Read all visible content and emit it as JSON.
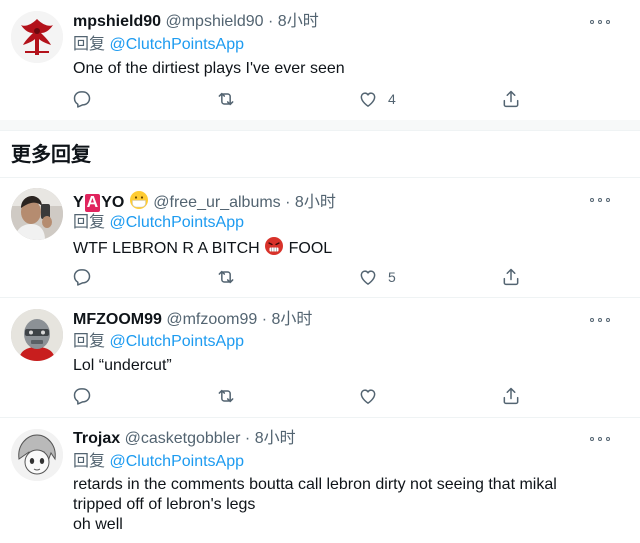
{
  "reply_prefix": "回复",
  "section_title": "更多回复",
  "tweets": [
    {
      "name": "mpshield90",
      "handle": "@mpshield90",
      "sep": "·",
      "time": "8小时",
      "reply_to": "@ClutchPointsApp",
      "lines": [
        "One of the dirtiest plays I've ever seen"
      ],
      "like_count": "4"
    },
    {
      "name_parts": [
        "Y",
        "A",
        "YO"
      ],
      "handle": "@free_ur_albums",
      "sep": "·",
      "time": "8小时",
      "reply_to": "@ClutchPointsApp",
      "lines": [
        "WTF LEBRON R A BITCH",
        "FOOL"
      ],
      "like_count": "5"
    },
    {
      "name": "MFZOOM99",
      "handle": "@mfzoom99",
      "sep": "·",
      "time": "8小时",
      "reply_to": "@ClutchPointsApp",
      "lines": [
        "Lol “undercut”"
      ],
      "like_count": ""
    },
    {
      "name": "Trojax",
      "handle": "@casketgobbler",
      "sep": "·",
      "time": "8小时",
      "reply_to": "@ClutchPointsApp",
      "lines": [
        "retards in the comments boutta call lebron dirty not seeing that mikal",
        "tripped off of lebron's legs",
        "oh well"
      ]
    }
  ],
  "icons": {
    "reply": "reply-icon",
    "retweet": "retweet-icon",
    "like": "like-icon",
    "share": "share-icon",
    "more": "more-icon"
  },
  "colors": {
    "link": "#1d9bf0",
    "secondary_text": "#536471",
    "primary_text": "#0f1419",
    "red_badge": "#e0245e"
  }
}
